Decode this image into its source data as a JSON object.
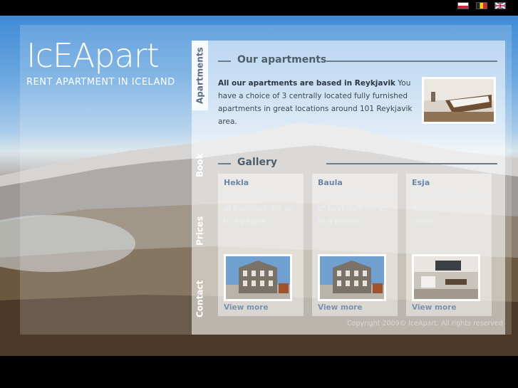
{
  "site": {
    "logo": "IcEApart",
    "tagline": "RENT APARTMENT IN ICELAND"
  },
  "languages": [
    {
      "code": "pl",
      "name": "polish-flag-icon"
    },
    {
      "code": "be",
      "name": "belgian-flag-icon"
    },
    {
      "code": "uk",
      "name": "uk-flag-icon"
    }
  ],
  "nav": {
    "tabs": [
      "Apartments",
      "Book",
      "Prices",
      "Contact"
    ],
    "active": "Apartments"
  },
  "apartments": {
    "heading": "Our apartments",
    "intro_bold": "All our apartments are based in Reykjavik",
    "intro_text": "You have a choice of 3 centrally located fully furnished apartments in great locations around 101 Reykjavik area."
  },
  "gallery": {
    "heading": "Gallery",
    "items": [
      {
        "title": "Hekla",
        "text": "Luxury flat in heart of Reykjavik for up to 4 people",
        "more": "View more"
      },
      {
        "title": "Baula",
        "text": "Luxury flat in heart of Reykjavik for up to 4 people",
        "more": "View more"
      },
      {
        "title": "Esja",
        "text": "Large flat in central Reykjavik with sea views.",
        "more": "View more"
      }
    ]
  },
  "footer": {
    "copyright": "Copyright 2009© IceApart. All rights reserved"
  }
}
